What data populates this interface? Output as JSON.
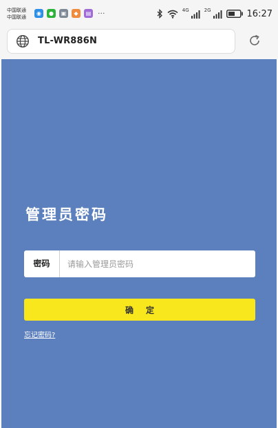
{
  "status_bar": {
    "carrier_lines": [
      "中国联通",
      "中国联通"
    ],
    "app_icons": [
      {
        "name": "qq-icon",
        "color": "#2e8fe6",
        "glyph": "◉"
      },
      {
        "name": "wechat-icon",
        "color": "#2bb33a",
        "glyph": "●"
      },
      {
        "name": "gallery-icon",
        "color": "#7d8a96",
        "glyph": "▣"
      },
      {
        "name": "shopping-icon",
        "color": "#f08a3c",
        "glyph": "◆"
      },
      {
        "name": "message-icon",
        "color": "#a06bd6",
        "glyph": "▤"
      }
    ],
    "more_indicator": "···",
    "network_1": "4G",
    "network_2": "2G",
    "time": "16:27"
  },
  "browser": {
    "url": "TL-WR886N"
  },
  "page": {
    "title": "管理员密码",
    "password_label": "密码",
    "password_placeholder": "请输入管理员密码",
    "password_value": "",
    "confirm_label": "确定",
    "forgot_link": "忘记密码?"
  },
  "colors": {
    "page_background": "#5c80bd",
    "confirm_button": "#f8e71c"
  }
}
